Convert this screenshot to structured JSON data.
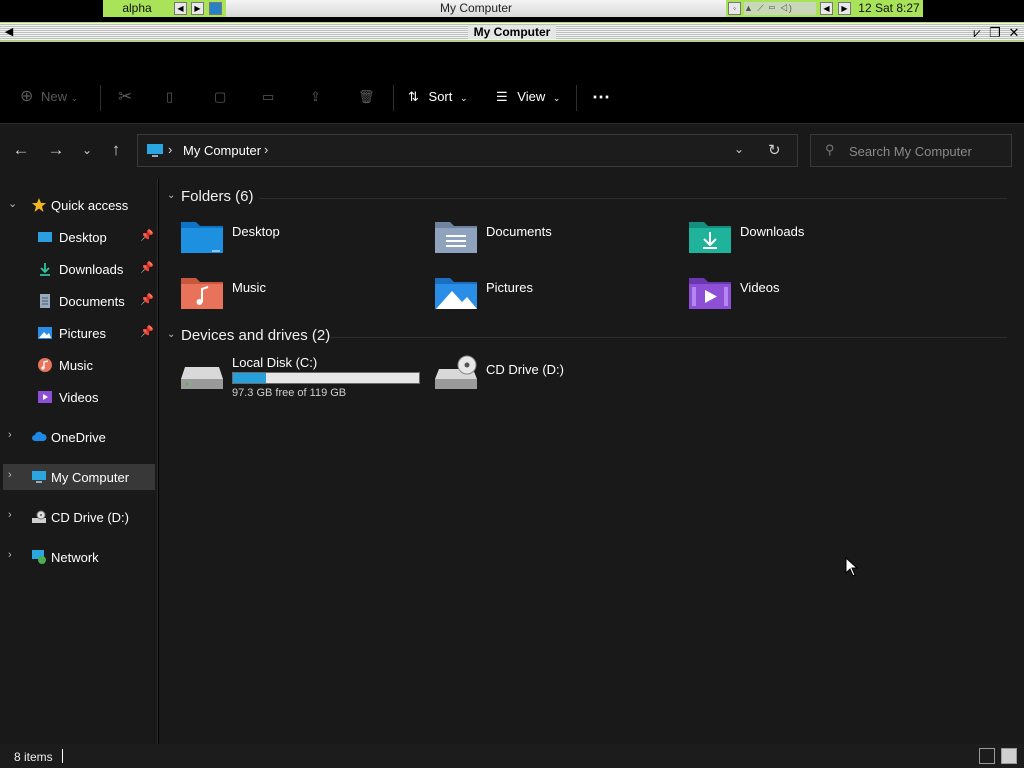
{
  "panel": {
    "workspace": "alpha",
    "window_title": "My Computer",
    "clock": "12 Sat 8:27"
  },
  "titlebar": {
    "title": "My Computer"
  },
  "toolbar": {
    "new_label": "New",
    "sort_label": "Sort",
    "view_label": "View",
    "more_label": "⋯"
  },
  "address": {
    "location": "My Computer",
    "search_placeholder": "Search My Computer"
  },
  "sidebar": {
    "items": [
      {
        "label": "Quick access",
        "icon": "star-icon"
      },
      {
        "label": "Desktop",
        "icon": "desktop-icon",
        "pinned": true
      },
      {
        "label": "Downloads",
        "icon": "download-icon",
        "pinned": true
      },
      {
        "label": "Documents",
        "icon": "documents-icon",
        "pinned": true
      },
      {
        "label": "Pictures",
        "icon": "pictures-icon",
        "pinned": true
      },
      {
        "label": "Music",
        "icon": "music-icon"
      },
      {
        "label": "Videos",
        "icon": "videos-icon"
      },
      {
        "label": "OneDrive",
        "icon": "cloud-icon"
      },
      {
        "label": "My Computer",
        "icon": "computer-icon",
        "selected": true
      },
      {
        "label": "CD Drive (D:)",
        "icon": "cd-drive-icon"
      },
      {
        "label": "Network",
        "icon": "network-icon"
      }
    ]
  },
  "folders": {
    "header": "Folders (6)",
    "items": [
      {
        "label": "Desktop",
        "color": "#1e90e0"
      },
      {
        "label": "Documents",
        "color": "#8fa3bf"
      },
      {
        "label": "Downloads",
        "color": "#1fb39c"
      },
      {
        "label": "Music",
        "color": "#e8735a"
      },
      {
        "label": "Pictures",
        "color": "#2a8ee6"
      },
      {
        "label": "Videos",
        "color": "#8d4fd6"
      }
    ]
  },
  "drives": {
    "header": "Devices and drives (2)",
    "items": [
      {
        "label": "Local Disk (C:)",
        "free_text": "97.3 GB free of 119 GB",
        "used_fraction": 0.18
      },
      {
        "label": "CD Drive (D:)"
      }
    ]
  },
  "status": {
    "count": "8 items"
  },
  "colors": {
    "accent_green": "#a8e35a",
    "drive_bar": "#26a0da"
  }
}
